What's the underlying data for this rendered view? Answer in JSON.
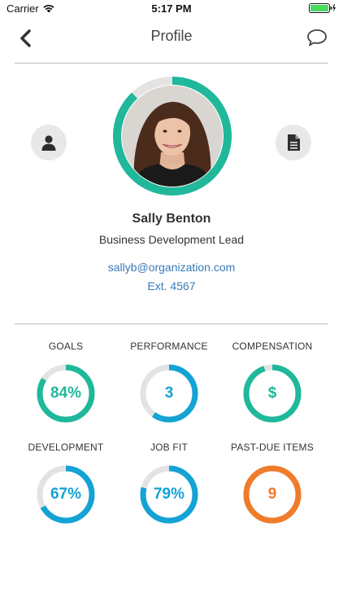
{
  "status_bar": {
    "carrier": "Carrier",
    "time": "5:17 PM"
  },
  "nav": {
    "title": "Profile"
  },
  "profile": {
    "name": "Sally Benton",
    "role": "Business Development Lead",
    "email": "sallyb@organization.com",
    "extension": "Ext. 4567",
    "ring_progress": 0.88
  },
  "colors": {
    "teal": "#1fb89b",
    "blue": "#13a3d4",
    "orange": "#ef7c2a",
    "track": "#e3e3e3"
  },
  "metrics": [
    {
      "label": "GOALS",
      "value": "84%",
      "progress": 0.84,
      "color": "#1fb89b"
    },
    {
      "label": "PERFORMANCE",
      "value": "3",
      "progress": 0.6,
      "color": "#13a3d4"
    },
    {
      "label": "COMPENSATION",
      "value": "$",
      "progress": 0.95,
      "color": "#1fb89b"
    },
    {
      "label": "DEVELOPMENT",
      "value": "67%",
      "progress": 0.67,
      "color": "#13a3d4"
    },
    {
      "label": "JOB FIT",
      "value": "79%",
      "progress": 0.79,
      "color": "#13a3d4"
    },
    {
      "label": "PAST-DUE ITEMS",
      "value": "9",
      "progress": 1.0,
      "color": "#ef7c2a"
    }
  ]
}
